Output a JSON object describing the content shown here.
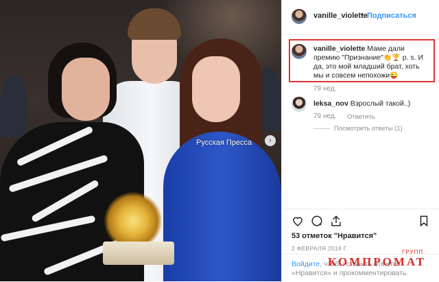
{
  "photo": {
    "watermark": "Русская Пресса",
    "next_icon": "chevron-right-icon"
  },
  "post": {
    "username": "vanille_violette",
    "dot": "•",
    "follow_label": "Подписаться",
    "caption": {
      "username": "vanille_violette",
      "text_1": " Маме дали премию \"Признание\"",
      "emoji_1": "👏🏆",
      "text_2": " p. s. И да, это мой младший брат, хоть мы и совсем непохожи",
      "emoji_2": "😜",
      "time": "79 нед."
    },
    "comments": [
      {
        "username": "leksa_nov",
        "text": " Взрослый такой..)",
        "time": "79 нед.",
        "reply_label": "Ответить",
        "view_replies": "Посмотреть ответы (1)"
      }
    ],
    "actions": [
      "heart-icon",
      "comment-icon",
      "share-icon",
      "bookmark-icon"
    ],
    "likes": "53 отметок \"Нравится\"",
    "date": "2 ФЕВРАЛЯ 2018 Г.",
    "login": {
      "link": "Войдите",
      "text": ", чтобы ставить отметки «Нравится» и прокомментировать."
    }
  },
  "watermark_logo": {
    "main": "КОМПРОМАТ",
    "sup": "ГРУПП"
  },
  "colors": {
    "accent": "#3897f0",
    "highlight_border": "#e0332e",
    "logo_red": "#d62a26",
    "muted_text": "#8e8e8e"
  }
}
